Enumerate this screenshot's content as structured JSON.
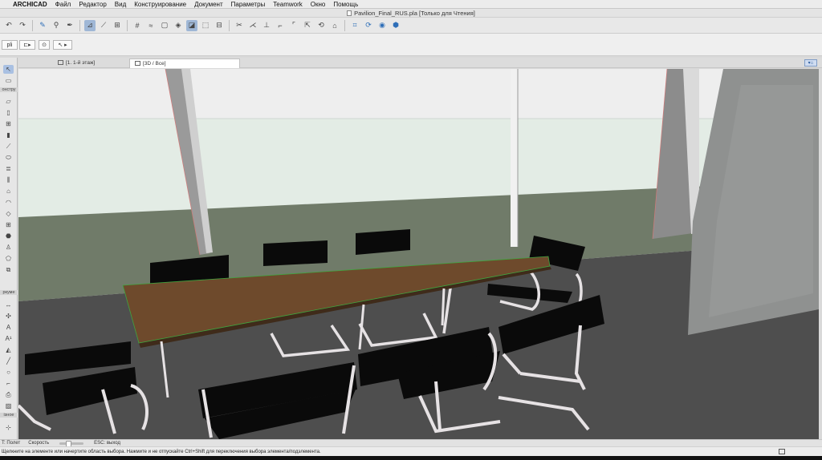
{
  "menubar": {
    "apple": "",
    "app_name": "ARCHICAD",
    "items": [
      "Файл",
      "Редактор",
      "Вид",
      "Конструирование",
      "Документ",
      "Параметры",
      "Teamwork",
      "Окно",
      "Помощь"
    ]
  },
  "window": {
    "title": "Pavilion_Final_RUS.pla [Только для Чтения]"
  },
  "infobox": {
    "layer_label": "pli"
  },
  "tabs": [
    {
      "label": "[1. 1-й этаж]",
      "selected": false,
      "icon": "floor-plan-icon"
    },
    {
      "label": "[3D / Все]",
      "selected": true,
      "icon": "3d-window-icon"
    }
  ],
  "toolbox": {
    "group_design": "онстру",
    "group_document": "ркуме",
    "group_more": "ізное"
  },
  "navbar": {
    "mode": "T: Полет",
    "speed_label": "Скорость",
    "exit_hint": "ESC: выход"
  },
  "status": {
    "text": "Щелкните на элементе или начертите область выбора. Нажмите и не отпускайте Ctrl+Shift для переключения выбора элемента/подэлемента."
  },
  "colors": {
    "accent": "#2f6fb8",
    "floor": "#4b5640",
    "table_top": "#6e4a2c",
    "chair_seat": "#0a0a0a",
    "frame": "#e6e2e4"
  }
}
